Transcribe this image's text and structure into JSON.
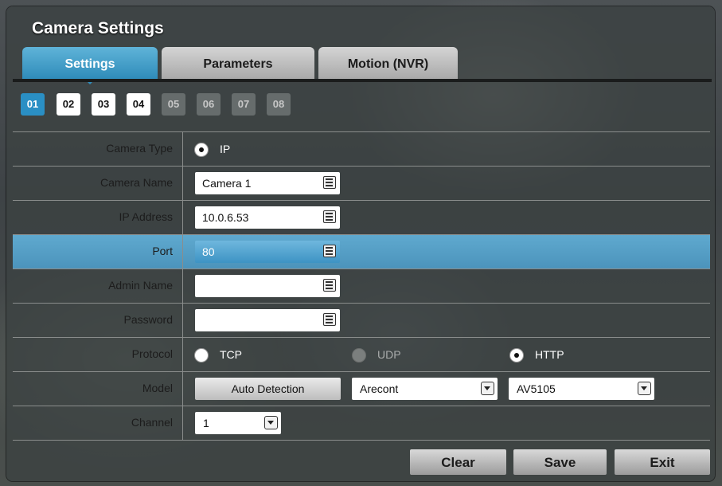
{
  "window": {
    "title": "Camera Settings"
  },
  "tabs": [
    {
      "label": "Settings",
      "active": true
    },
    {
      "label": "Parameters",
      "active": false
    },
    {
      "label": "Motion (NVR)",
      "active": false
    }
  ],
  "channels": [
    {
      "label": "01",
      "state": "selected"
    },
    {
      "label": "02",
      "state": "enabled"
    },
    {
      "label": "03",
      "state": "enabled"
    },
    {
      "label": "04",
      "state": "enabled"
    },
    {
      "label": "05",
      "state": "disabled"
    },
    {
      "label": "06",
      "state": "disabled"
    },
    {
      "label": "07",
      "state": "disabled"
    },
    {
      "label": "08",
      "state": "disabled"
    }
  ],
  "form": {
    "camera_type": {
      "label": "Camera Type",
      "option": "IP",
      "selected": true
    },
    "camera_name": {
      "label": "Camera Name",
      "value": "Camera 1"
    },
    "ip_address": {
      "label": "IP Address",
      "value": "10.0.6.53"
    },
    "port": {
      "label": "Port",
      "value": "80",
      "highlighted": true
    },
    "admin_name": {
      "label": "Admin Name",
      "value": ""
    },
    "password": {
      "label": "Password",
      "value": ""
    },
    "protocol": {
      "label": "Protocol",
      "options": [
        {
          "label": "TCP",
          "selected": false,
          "disabled": false
        },
        {
          "label": "UDP",
          "selected": false,
          "disabled": true
        },
        {
          "label": "HTTP",
          "selected": true,
          "disabled": false
        }
      ]
    },
    "model": {
      "label": "Model",
      "auto_detect_label": "Auto Detection",
      "brand": "Arecont",
      "model_name": "AV5105"
    },
    "channel": {
      "label": "Channel",
      "value": "1"
    }
  },
  "actions": {
    "clear": "Clear",
    "save": "Save",
    "exit": "Exit"
  },
  "colors": {
    "accent": "#2f8cba",
    "highlight_row": "#4b93bb",
    "panel": "#3c4242"
  }
}
